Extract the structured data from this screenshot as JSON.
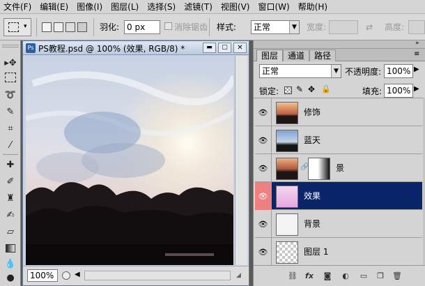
{
  "menu": [
    "文件(F)",
    "编辑(E)",
    "图像(I)",
    "图层(L)",
    "选择(S)",
    "滤镜(T)",
    "视图(V)",
    "窗口(W)",
    "帮助(H)"
  ],
  "options": {
    "feather_label": "羽化:",
    "feather_value": "0 px",
    "antialias_label": "消除锯齿",
    "style_label": "样式:",
    "style_value": "正常",
    "width_label": "宽度:",
    "height_label": "高度:"
  },
  "document": {
    "title": "PS教程.psd @ 100% (效果, RGB/8) *",
    "zoom": "100%",
    "badge": "Ps"
  },
  "layers_panel": {
    "tabs": [
      "图层",
      "通道",
      "路径"
    ],
    "blend_mode": "正常",
    "opacity_label": "不透明度:",
    "opacity_value": "100%",
    "lock_label": "锁定:",
    "fill_label": "填充:",
    "fill_value": "100%",
    "layers": [
      {
        "name": "修饰",
        "selected": false
      },
      {
        "name": "蓝天",
        "selected": false
      },
      {
        "name": "景",
        "selected": false
      },
      {
        "name": "效果",
        "selected": true
      },
      {
        "name": "背景",
        "selected": false
      },
      {
        "name": "图层 1",
        "selected": false
      }
    ]
  },
  "colors": {
    "selection": "#0a246a",
    "eye_highlight": "#ef8080",
    "title_blue": "#3a6fb0"
  }
}
